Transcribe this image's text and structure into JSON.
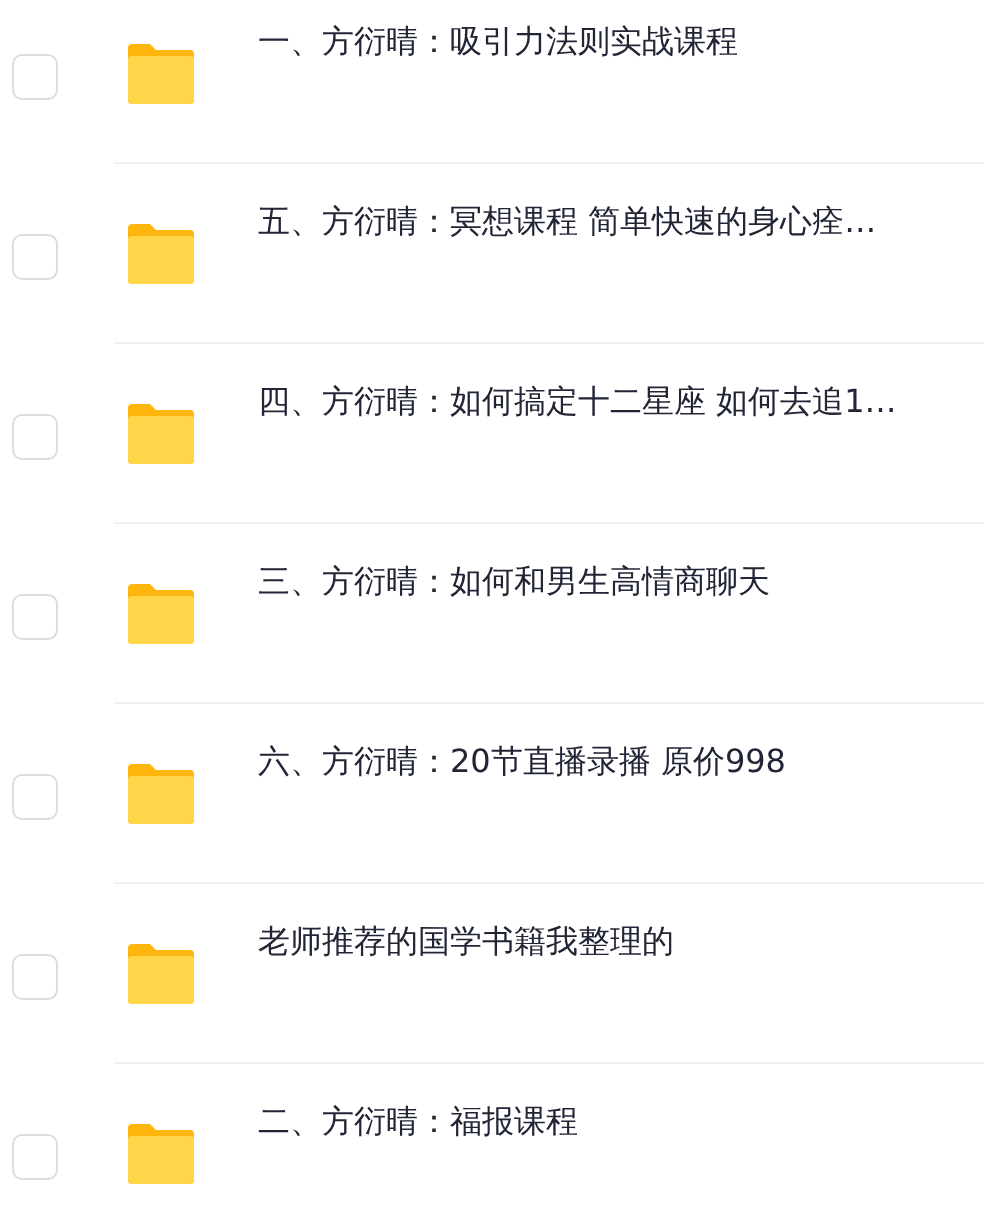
{
  "files": [
    {
      "name": "一、方衍晴：吸引力法则实战课程",
      "checked": false
    },
    {
      "name": "五、方衍晴：冥想课程 简单快速的身心痊…",
      "checked": false
    },
    {
      "name": "四、方衍晴：如何搞定十二星座 如何去追1…",
      "checked": false
    },
    {
      "name": "三、方衍晴：如何和男生高情商聊天",
      "checked": false
    },
    {
      "name": "六、方衍晴：20节直播录播 原价998",
      "checked": false
    },
    {
      "name": "老师推荐的国学书籍我整理的",
      "checked": false
    },
    {
      "name": "二、方衍晴：福报课程",
      "checked": false
    }
  ]
}
